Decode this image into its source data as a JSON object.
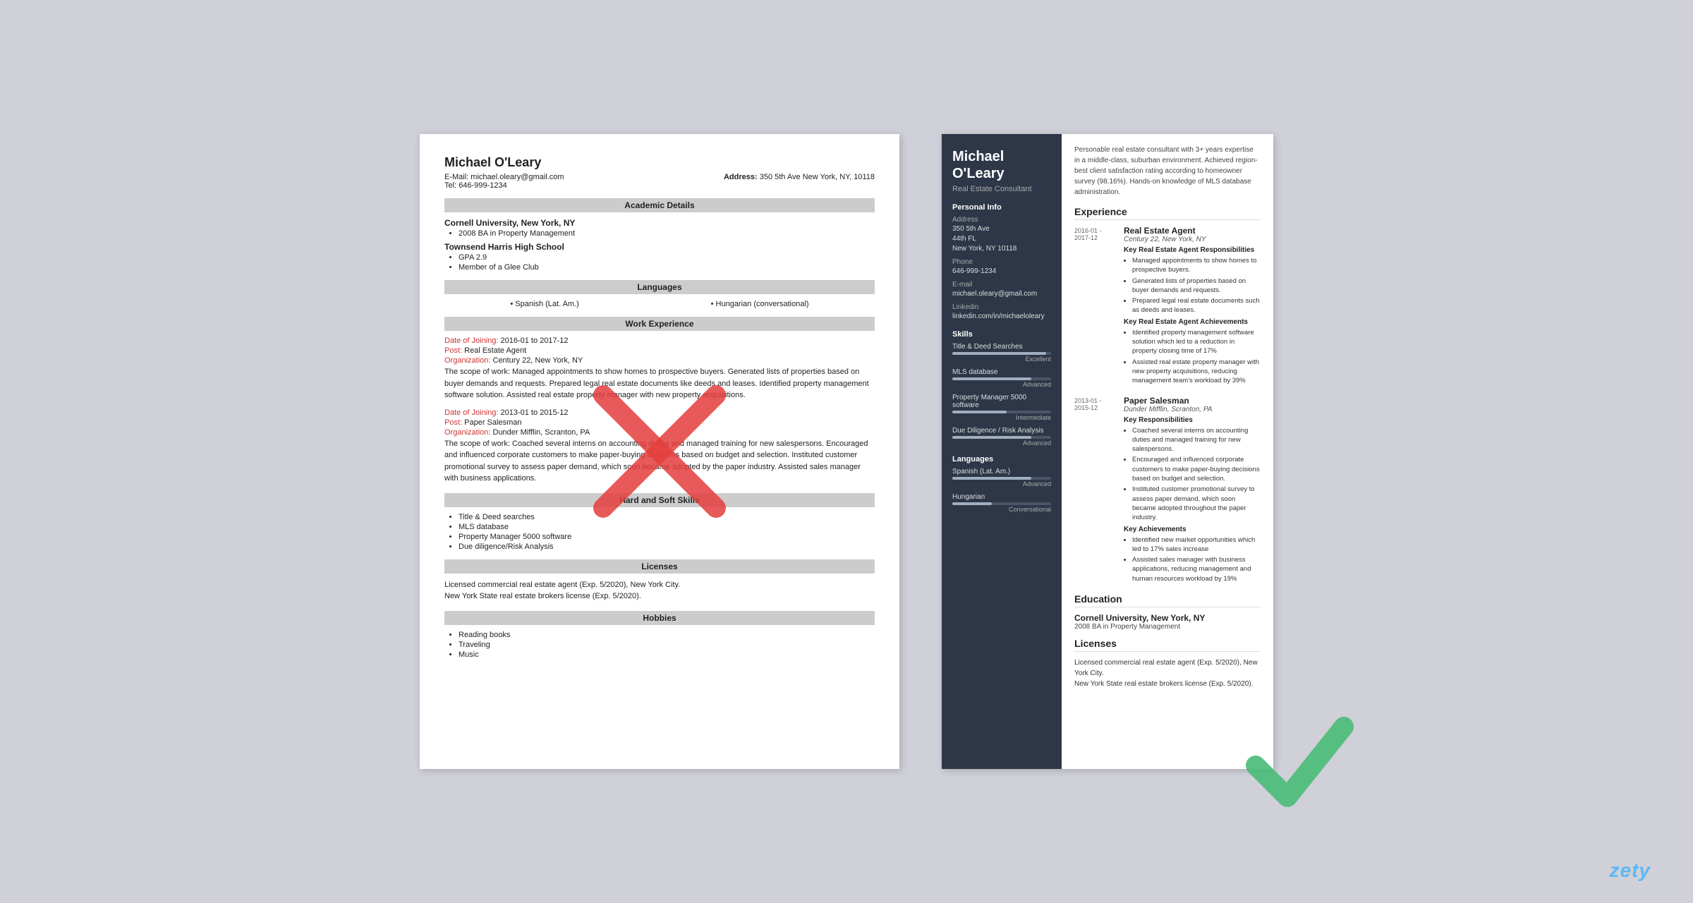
{
  "left_resume": {
    "name": "Michael O'Leary",
    "email_label": "E-Mail:",
    "email": "michael.oleary@gmail.com",
    "address_label": "Address:",
    "address": "350 5th Ave New York, NY, 10118",
    "tel_label": "Tel:",
    "tel": "646-999-1234",
    "sections": {
      "academic": "Academic Details",
      "languages": "Languages",
      "work": "Work Experience",
      "skills": "Hard and Soft Skills",
      "licenses": "Licenses",
      "hobbies": "Hobbies"
    },
    "education": [
      {
        "institution": "Cornell University, New York, NY",
        "items": [
          "2008 BA in Property Management"
        ]
      },
      {
        "institution": "Townsend Harris High School",
        "items": [
          "GPA 2.9",
          "Member of a Glee Club"
        ]
      }
    ],
    "languages": [
      "Spanish (Lat. Am.)",
      "Hungarian (conversational)"
    ],
    "work_entries": [
      {
        "date_label": "Date of Joining:",
        "date": "2016-01 to 2017-12",
        "post_label": "Post:",
        "post": "Real Estate Agent",
        "org_label": "Organization:",
        "org": "Century 22, New York, NY",
        "scope_label": "The scope of work:",
        "scope": "Managed appointments to show homes to prospective buyers. Generated lists of properties based on buyer demands and requests. Prepared legal real estate documents like deeds and leases. Identified property management software solution. Assisted real estate property manager with new property acquisitions."
      },
      {
        "date_label": "Date of Joining:",
        "date": "2013-01 to 2015-12",
        "post_label": "Post:",
        "post": "Paper Salesman",
        "org_label": "Organization:",
        "org": "Dunder Mifflin, Scranton, PA",
        "scope_label": "The scope of work:",
        "scope": "Coached several interns on accounting duties and managed training for new salespersons. Encouraged and influenced corporate customers to make paper-buying decisions based on budget and selection. Instituted customer promotional survey to assess paper demand, which soon became adopted by the paper industry. Assisted sales manager with business applications."
      }
    ],
    "skills": [
      "Title & Deed searches",
      "MLS database",
      "Property Manager 5000 software",
      "Due diligence/Risk Analysis"
    ],
    "licenses_text": "Licensed commercial real estate agent (Exp. 5/2020), New York City.\nNew York State real estate brokers license (Exp. 5/2020).",
    "hobbies": [
      "Reading books",
      "Traveling",
      "Music"
    ]
  },
  "right_resume": {
    "name": "Michael\nO'Leary",
    "job_title": "Real Estate Consultant",
    "summary": "Personable real estate consultant with 3+ years expertise in a middle-class, suburban environment. Achieved region-best client satisfaction rating according to homeowner survey (98.16%). Hands-on knowledge of MLS database administration.",
    "personal_info_title": "Personal Info",
    "personal_info": {
      "address_label": "Address",
      "address_lines": [
        "350 5th Ave",
        "44th FL",
        "New York, NY 10118"
      ],
      "phone_label": "Phone",
      "phone": "646-999-1234",
      "email_label": "E-mail",
      "email": "michael.oleary@gmail.com",
      "linkedin_label": "Linkedin",
      "linkedin": "linkedin.com/in/michaeloleary"
    },
    "skills_title": "Skills",
    "skills": [
      {
        "name": "Title & Deed Searches",
        "level": "Excellent",
        "pct": 95
      },
      {
        "name": "MLS database",
        "level": "Advanced",
        "pct": 80
      },
      {
        "name": "Property Manager 5000 software",
        "level": "Intermediate",
        "pct": 55
      },
      {
        "name": "Due Diligence / Risk Analysis",
        "level": "Advanced",
        "pct": 80
      }
    ],
    "languages_title": "Languages",
    "languages": [
      {
        "name": "Spanish (Lat. Am.)",
        "level": "Advanced",
        "pct": 80
      },
      {
        "name": "Hungarian",
        "level": "Conversational",
        "pct": 40
      }
    ],
    "experience_title": "Experience",
    "experiences": [
      {
        "date": "2016-01 -\n2017-12",
        "role": "Real Estate Agent",
        "company": "Century 22, New York, NY",
        "responsibilities_title": "Key Real Estate Agent Responsibilities",
        "responsibilities": [
          "Managed appointments to show homes to prospective buyers.",
          "Generated lists of properties based on buyer demands and requests.",
          "Prepared legal real estate documents such as deeds and leases."
        ],
        "achievements_title": "Key Real Estate Agent Achievements",
        "achievements": [
          "Identified property management software solution which led to a reduction in property closing time of 17%",
          "Assisted real estate property manager with new property acquisitions, reducing management team's workload by 39%"
        ]
      },
      {
        "date": "2013-01 -\n2015-12",
        "role": "Paper Salesman",
        "company": "Dunder Mifflin, Scranton, PA",
        "responsibilities_title": "Key Responsibilities",
        "responsibilities": [
          "Coached several interns on accounting duties and managed training for new salespersons.",
          "Encouraged and influenced corporate customers to make paper-buying decisions based on budget and selection.",
          "Instituted customer promotional survey to assess paper demand, which soon became adopted throughout the paper industry."
        ],
        "achievements_title": "Key Achievements",
        "achievements": [
          "Identified new market opportunities which led to 17% sales increase",
          "Assisted sales manager with business applications, reducing management and human resources workload by 19%"
        ]
      }
    ],
    "education_title": "Education",
    "education": [
      {
        "school": "Cornell University, New York, NY",
        "degree": "2008 BA in Property Management"
      }
    ],
    "licenses_title": "Licenses",
    "licenses_text": "Licensed commercial real estate agent (Exp. 5/2020), New York City.\nNew York State real estate brokers license (Exp. 5/2020)."
  },
  "zety_label": "zety"
}
